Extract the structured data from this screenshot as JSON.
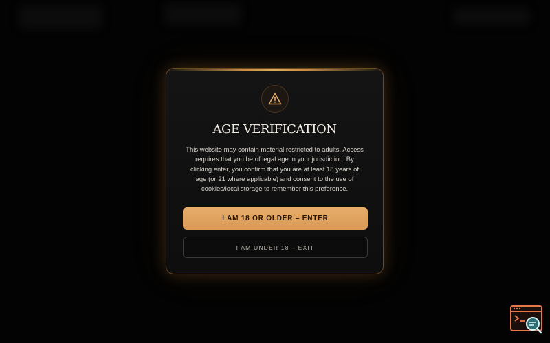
{
  "modal": {
    "icon": "warning-triangle-icon",
    "title": "AGE VERIFICATION",
    "message": "This website may contain material restricted to adults. Access requires that you be of legal age in your jurisdiction. By clicking enter, you confirm that you are at least 18 years of age (or 21 where applicable) and consent to the use of cookies/local storage to remember this preference.",
    "enter_label": "I AM 18 OR OLDER – ENTER",
    "exit_label": "I AM UNDER 18 – EXIT"
  },
  "corner_widget": {
    "icon": "terminal-search-icon"
  },
  "colors": {
    "accent": "#e0a867",
    "accent_button": "#e0a565",
    "border": "#6b4a22",
    "background": "#030303",
    "modal_bg": "#111111",
    "widget_orange": "#e8784a",
    "widget_teal": "#2a6f74"
  }
}
